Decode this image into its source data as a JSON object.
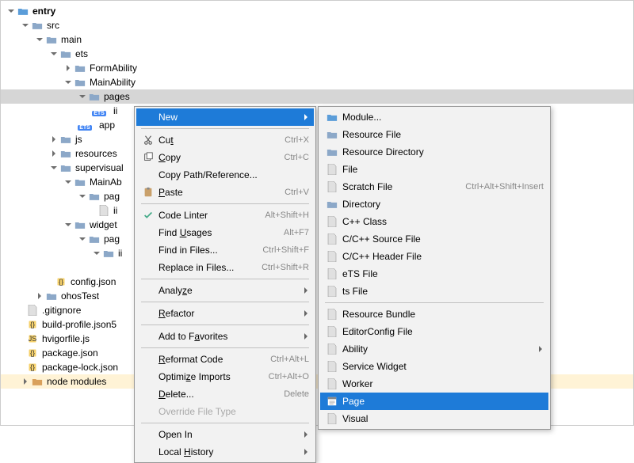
{
  "tree": {
    "entry": "entry",
    "src": "src",
    "main": "main",
    "ets": "ets",
    "FormAbility": "FormAbility",
    "MainAbility": "MainAbility",
    "pages": "pages",
    "i1": "ii",
    "app": "app",
    "js": "js",
    "resources": "resources",
    "supervisual": "supervisual",
    "MainAb": "MainAb",
    "pag": "pag",
    "ifile": "ii",
    "widget": "widget",
    "pag2": "pag",
    "i2": "ii",
    "config": "config.json",
    "ohosTest": "ohosTest",
    "gitignore": ".gitignore",
    "buildprofile": "build-profile.json5",
    "hvigorfile": "hvigorfile.js",
    "package": "package.json",
    "packagelock": "package-lock.json",
    "nodemodules": "node modules"
  },
  "context_menu": {
    "new": "New",
    "cut": "Cut",
    "copy": "Copy",
    "copypath": "Copy Path/Reference...",
    "paste": "Paste",
    "codelinter": "Code Linter",
    "findusages": "Find Usages",
    "findinfiles": "Find in Files...",
    "replaceinfiles": "Replace in Files...",
    "analyze": "Analyze",
    "refactor": "Refactor",
    "addfav": "Add to Favorites",
    "reformat": "Reformat Code",
    "optimize": "Optimize Imports",
    "delete": "Delete...",
    "override": "Override File Type",
    "openin": "Open In",
    "localhistory": "Local History",
    "sc_cut": "Ctrl+X",
    "sc_copy": "Ctrl+C",
    "sc_paste": "Ctrl+V",
    "sc_linter": "Alt+Shift+H",
    "sc_usages": "Alt+F7",
    "sc_findfiles": "Ctrl+Shift+F",
    "sc_replacefiles": "Ctrl+Shift+R",
    "sc_reformat": "Ctrl+Alt+L",
    "sc_optimize": "Ctrl+Alt+O",
    "sc_delete": "Delete"
  },
  "submenu": {
    "module": "Module...",
    "resfile": "Resource File",
    "resdir": "Resource Directory",
    "file": "File",
    "scratch": "Scratch File",
    "sc_scratch": "Ctrl+Alt+Shift+Insert",
    "directory": "Directory",
    "cppclass": "C++ Class",
    "ccsrc": "C/C++ Source File",
    "cchdr": "C/C++ Header File",
    "etsfile": "eTS File",
    "tsfile": "ts File",
    "resbundle": "Resource Bundle",
    "editorconfig": "EditorConfig File",
    "ability": "Ability",
    "servicewidget": "Service Widget",
    "worker": "Worker",
    "page": "Page",
    "visual": "Visual"
  }
}
